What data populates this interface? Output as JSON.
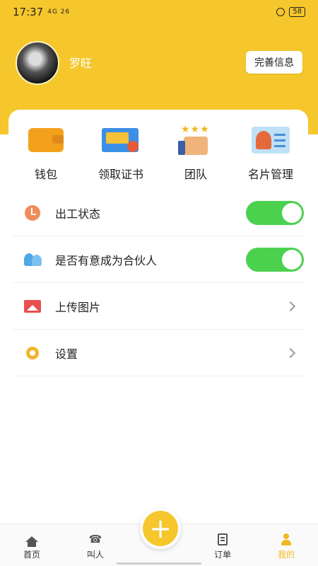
{
  "status_bar": {
    "time": "17:37",
    "network": "4G 26",
    "battery": "58"
  },
  "profile": {
    "username": "罗旺",
    "complete_info_label": "完善信息"
  },
  "grid": {
    "items": [
      {
        "label": "钱包",
        "icon": "wallet-icon"
      },
      {
        "label": "领取证书",
        "icon": "certificate-icon"
      },
      {
        "label": "团队",
        "icon": "team-icon"
      },
      {
        "label": "名片管理",
        "icon": "business-card-icon"
      }
    ]
  },
  "menu": {
    "items": [
      {
        "label": "出工状态",
        "icon": "clock-icon",
        "control": "toggle",
        "on": true
      },
      {
        "label": "是否有意成为合伙人",
        "icon": "partner-icon",
        "control": "toggle",
        "on": true
      },
      {
        "label": "上传图片",
        "icon": "picture-icon",
        "control": "chevron"
      },
      {
        "label": "设置",
        "icon": "gear-icon",
        "control": "chevron"
      }
    ]
  },
  "tabbar": {
    "items": [
      {
        "label": "首页",
        "icon": "home-icon"
      },
      {
        "label": "叫人",
        "icon": "phone-icon"
      },
      {
        "label": "订单",
        "icon": "order-icon"
      },
      {
        "label": "我的",
        "icon": "person-icon",
        "active": true
      }
    ],
    "fab_symbol": "+"
  },
  "colors": {
    "brand_yellow": "#f5c72c",
    "toggle_green": "#4cd14f",
    "active_tab": "#f0b81f"
  }
}
